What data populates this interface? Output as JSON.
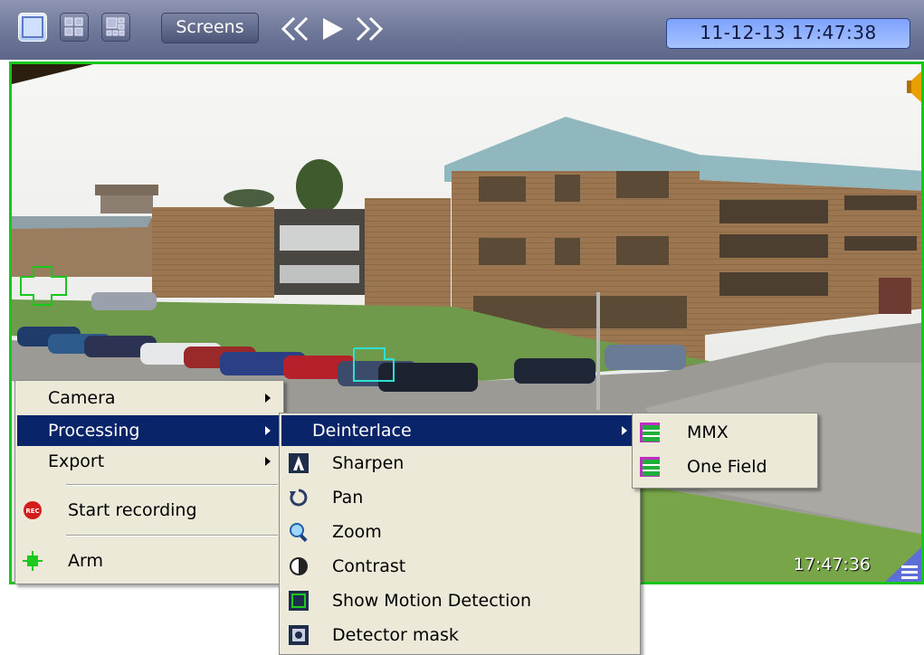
{
  "toolbar": {
    "layout_buttons": [
      "single-view",
      "four-view",
      "multi-view"
    ],
    "screens_label": "Screens",
    "nav_icons": [
      "rewind-icon",
      "play-icon",
      "fast-forward-icon"
    ],
    "datetime": "11-12-13  17:47:38"
  },
  "video": {
    "timestamp": "17:47:36",
    "border_color": "#17c81a"
  },
  "context_menu": {
    "items": [
      {
        "label": "Camera",
        "submenu": true
      },
      {
        "label": "Processing",
        "submenu": true,
        "highlighted": true
      },
      {
        "label": "Export",
        "submenu": true
      },
      {
        "label": "Start recording",
        "icon": "rec-icon"
      },
      {
        "label": "Arm",
        "icon": "arm-icon"
      }
    ]
  },
  "processing_menu": {
    "items": [
      {
        "label": "Deinterlace",
        "submenu": true,
        "highlighted": true
      },
      {
        "label": "Sharpen",
        "icon": "sharpen-icon"
      },
      {
        "label": "Pan",
        "icon": "pan-icon"
      },
      {
        "label": "Zoom",
        "icon": "zoom-icon"
      },
      {
        "label": "Contrast",
        "icon": "contrast-icon"
      },
      {
        "label": "Show Motion Detection",
        "icon": "motion-detection-icon"
      },
      {
        "label": "Detector mask",
        "icon": "detector-mask-icon"
      }
    ]
  },
  "deinterlace_menu": {
    "items": [
      {
        "label": "MMX",
        "icon": "deinterlace-mode-icon"
      },
      {
        "label": "One Field",
        "icon": "deinterlace-mode-icon"
      }
    ]
  },
  "colors": {
    "toolbar": "#6f7799",
    "highlight": "#0a246a",
    "menu_bg": "#ece9d8",
    "clock_bg": "#93b4ff",
    "motion_box": "#17c81a"
  }
}
